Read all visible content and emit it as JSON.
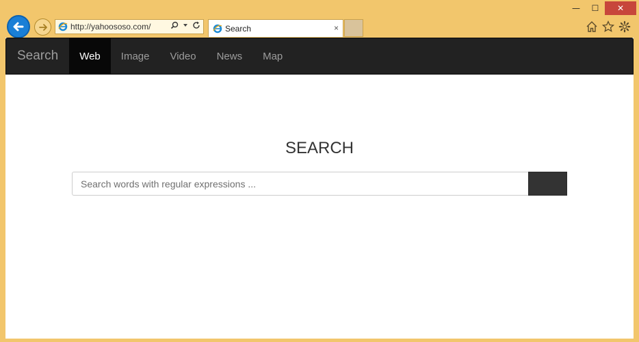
{
  "browser": {
    "url": "http://yahoososo.com/",
    "tab_title": "Search",
    "tab_close": "×",
    "window": {
      "minimize": "—",
      "maximize": "☐",
      "close": "✕"
    }
  },
  "navbar": {
    "brand": "Search",
    "items": [
      {
        "label": "Web",
        "active": true
      },
      {
        "label": "Image",
        "active": false
      },
      {
        "label": "Video",
        "active": false
      },
      {
        "label": "News",
        "active": false
      },
      {
        "label": "Map",
        "active": false
      }
    ]
  },
  "main": {
    "heading": "SEARCH",
    "search_placeholder": "Search words with regular expressions ..."
  },
  "colors": {
    "frame": "#f2c66c",
    "navbar": "#222222",
    "active_nav": "#080808",
    "search_button": "#333333"
  }
}
